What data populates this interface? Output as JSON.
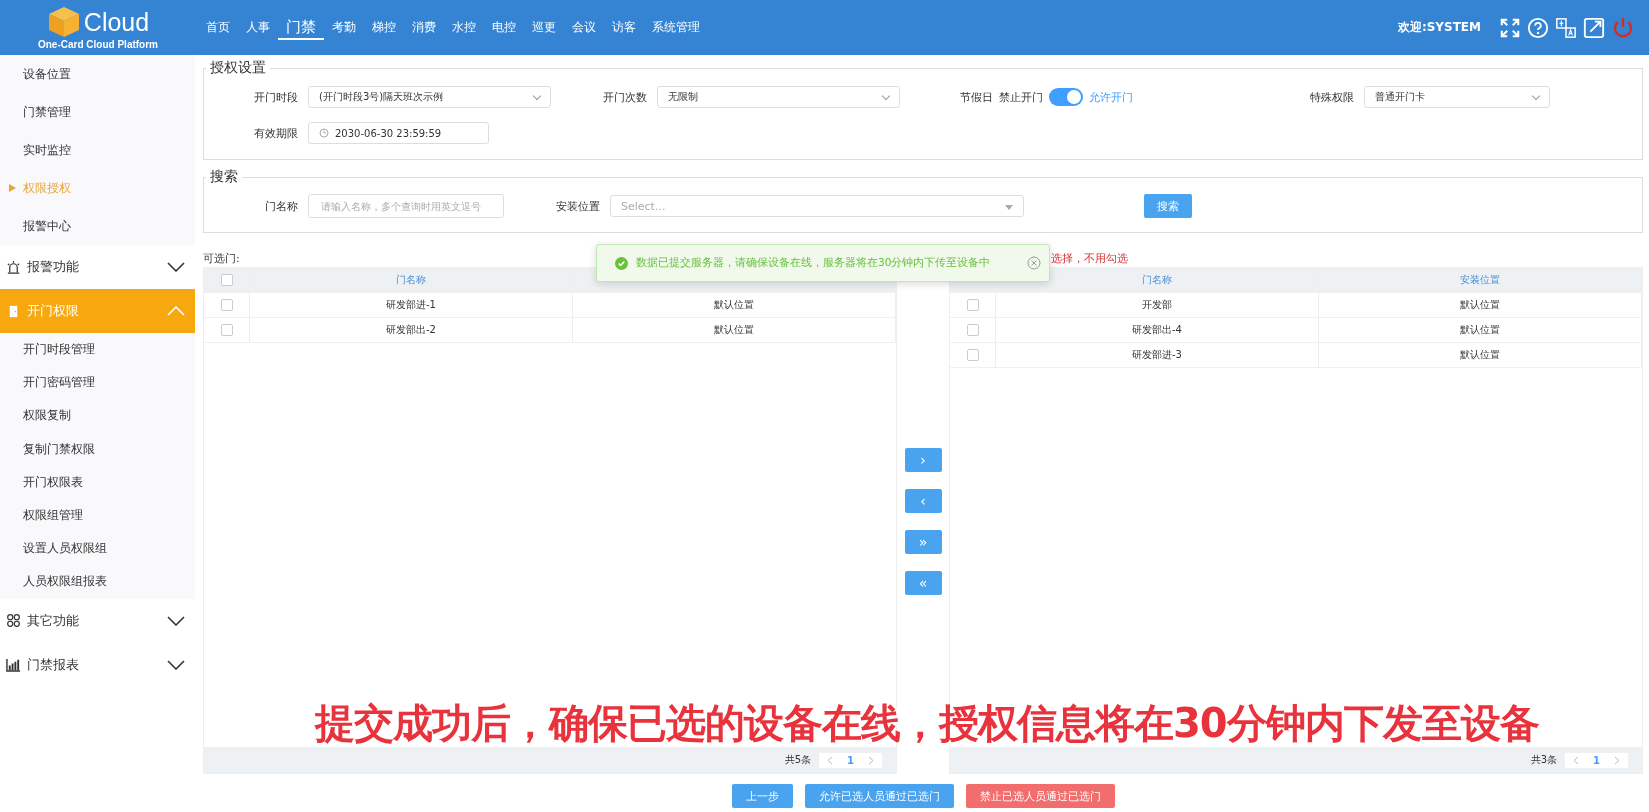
{
  "header": {
    "logo_text": "Cloud",
    "logo_subtitle": "One-Card Cloud Platform",
    "welcome": "欢迎:SYSTEM",
    "nav": [
      {
        "label": "首页",
        "selected": false
      },
      {
        "label": "人事",
        "selected": false
      },
      {
        "label": "门禁",
        "selected": true
      },
      {
        "label": "考勤",
        "selected": false
      },
      {
        "label": "梯控",
        "selected": false
      },
      {
        "label": "消费",
        "selected": false
      },
      {
        "label": "水控",
        "selected": false
      },
      {
        "label": "电控",
        "selected": false
      },
      {
        "label": "巡更",
        "selected": false
      },
      {
        "label": "会议",
        "selected": false
      },
      {
        "label": "访客",
        "selected": false
      },
      {
        "label": "系统管理",
        "selected": false
      }
    ]
  },
  "sidebar": {
    "items": [
      {
        "label": "设备位置",
        "selected": false
      },
      {
        "label": "门禁管理",
        "selected": false
      },
      {
        "label": "实时监控",
        "selected": false
      },
      {
        "label": "权限授权",
        "selected": true
      },
      {
        "label": "报警中心",
        "selected": false
      }
    ],
    "groups": [
      {
        "label": "报警功能",
        "selected": false,
        "expanded": false
      },
      {
        "label": "开门权限",
        "selected": true,
        "expanded": true,
        "children": [
          {
            "label": "开门时段管理"
          },
          {
            "label": "开门密码管理"
          },
          {
            "label": "权限复制"
          },
          {
            "label": "复制门禁权限"
          },
          {
            "label": "开门权限表"
          },
          {
            "label": "权限组管理"
          },
          {
            "label": "设置人员权限组"
          },
          {
            "label": "人员权限组报表"
          }
        ]
      },
      {
        "label": "其它功能",
        "selected": false,
        "expanded": false
      },
      {
        "label": "门禁报表",
        "selected": false,
        "expanded": false
      }
    ]
  },
  "auth": {
    "title": "授权设置",
    "period": {
      "label": "开门时段",
      "value": "(开门时段3号)隔天班次示例"
    },
    "times": {
      "label": "开门次数",
      "value": "无限制"
    },
    "holiday": {
      "label": "节假日",
      "off_label": "禁止开门",
      "on_label": "允许开门",
      "on": true
    },
    "special": {
      "label": "特殊权限",
      "value": "普通开门卡"
    },
    "expiry": {
      "label": "有效期限",
      "value": "2030-06-30 23:59:59"
    }
  },
  "search": {
    "title": "搜索",
    "name": {
      "label": "门名称",
      "placeholder": "请输入名称，多个查询时用英文逗号"
    },
    "location": {
      "label": "安装位置",
      "placeholder": "Select..."
    },
    "button": "搜索"
  },
  "left_table": {
    "label": "可选门:",
    "header_checked": false,
    "columns": [
      "门名称"
    ],
    "rows": [
      {
        "checked": false,
        "cells": [
          "研发部进-1",
          "默认位置"
        ]
      },
      {
        "checked": false,
        "cells": [
          "研发部出-2",
          "默认位置"
        ]
      }
    ],
    "total": "共5条",
    "page": "1"
  },
  "transfer": [
    "›",
    "‹",
    "»",
    "«"
  ],
  "right_table": {
    "note": "选择，不用勾选",
    "columns": [
      "门名称",
      "安装位置"
    ],
    "rows": [
      {
        "checked": false,
        "cells": [
          "开发部",
          "默认位置"
        ]
      },
      {
        "checked": false,
        "cells": [
          "研发部出-4",
          "默认位置"
        ]
      },
      {
        "checked": false,
        "cells": [
          "研发部进-3",
          "默认位置"
        ]
      }
    ],
    "total": "共3条",
    "page": "1"
  },
  "buttons": [
    {
      "label": "上一步",
      "kind": "primary"
    },
    {
      "label": "允许已选人员通过已选门",
      "kind": "primary"
    },
    {
      "label": "禁止已选人员通过已选门",
      "kind": "danger"
    }
  ],
  "toast": {
    "text": "数据已提交服务器，请确保设备在线，服务器将在30分钟内下传至设备中"
  },
  "caption": {
    "text": "提交成功后，确保已选的设备在线，授权信息将在30分钟内下发至设备"
  }
}
